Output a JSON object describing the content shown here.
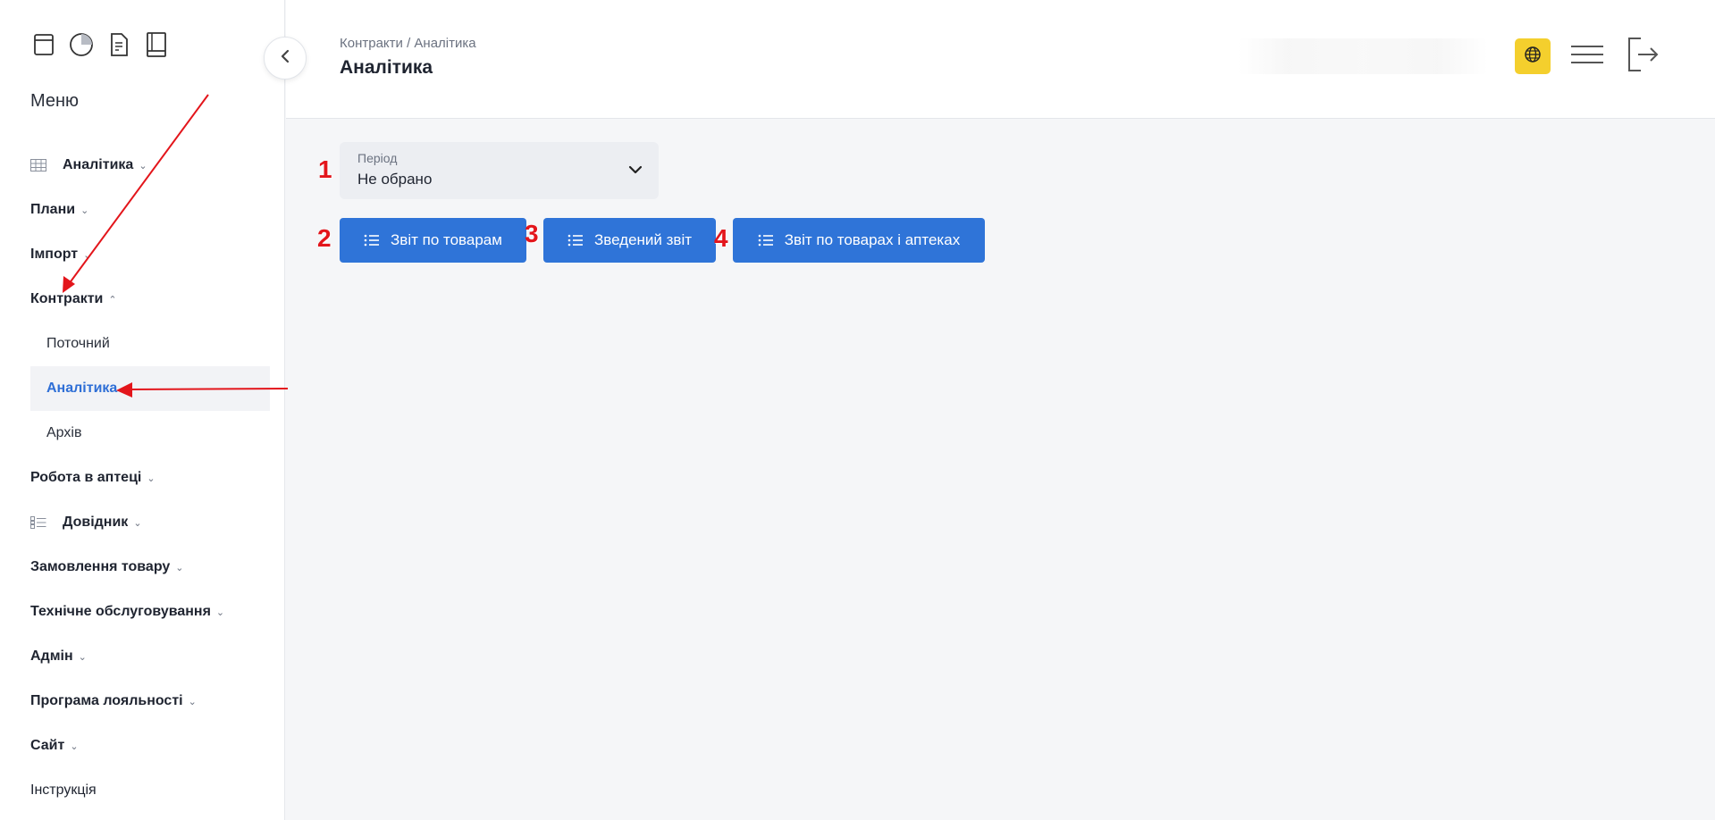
{
  "sidebar": {
    "menu_title": "Меню",
    "top_icons": [
      "archive-icon",
      "pie-chart-icon",
      "document-icon",
      "book-icon"
    ],
    "items": [
      {
        "label": "Аналітика",
        "icon": "grid-table-icon",
        "chevron": "⌄"
      },
      {
        "label": "Плани",
        "chevron": "⌄"
      },
      {
        "label": "Імпорт",
        "chevron": "⌄"
      },
      {
        "label": "Контракти",
        "chevron": "⌃"
      },
      {
        "label": "Робота в аптеці",
        "chevron": "⌄"
      },
      {
        "label": "Довідник",
        "icon": "list-details-icon",
        "chevron": "⌄"
      },
      {
        "label": "Замовлення товару",
        "chevron": "⌄"
      },
      {
        "label": "Технічне обслуговування",
        "chevron": "⌄"
      },
      {
        "label": "Адмін",
        "chevron": "⌄"
      },
      {
        "label": "Програма лояльності",
        "chevron": "⌄"
      },
      {
        "label": "Сайт",
        "chevron": "⌄"
      },
      {
        "label": "Інструкція"
      }
    ],
    "contracts_sub": [
      {
        "label": "Поточний"
      },
      {
        "label": "Аналітика",
        "active": true
      },
      {
        "label": "Архів"
      }
    ]
  },
  "header": {
    "breadcrumb": "Контракти / Аналітика",
    "title": "Аналітика"
  },
  "period": {
    "label": "Період",
    "value": "Не обрано"
  },
  "buttons": {
    "products_report": "Звіт по товарам",
    "summary_report": "Зведений звіт",
    "products_pharmacies_report": "Звіт по товарах і аптеках"
  },
  "annotations": [
    "1",
    "2",
    "3",
    "4"
  ],
  "colors": {
    "accent": "#2f74d8",
    "active_link": "#2f6fd6",
    "lang_button": "#f4cf2d",
    "annotation": "#e3151b"
  }
}
